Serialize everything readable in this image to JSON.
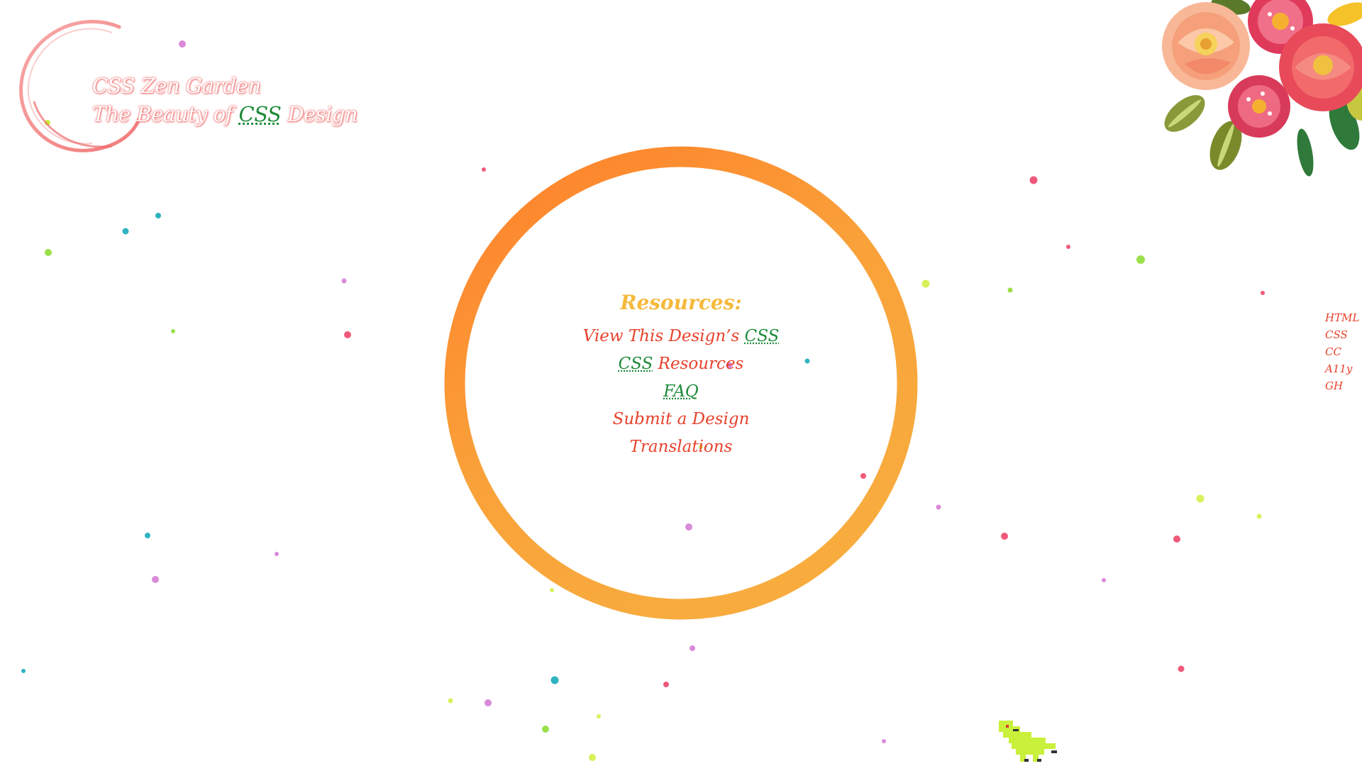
{
  "header": {
    "title": "CSS Zen Garden",
    "tagline_prefix": "The Beauty of ",
    "tagline_css": "CSS",
    "tagline_suffix": " Design"
  },
  "resources": {
    "heading": "Resources:",
    "links": [
      {
        "prefix": "View This Design’s ",
        "abbr": "CSS",
        "suffix": ""
      },
      {
        "prefix": "",
        "abbr": "CSS",
        "suffix": " Resources"
      },
      {
        "prefix": "",
        "abbr": "FAQ",
        "suffix": ""
      },
      {
        "prefix": "Submit a Design",
        "abbr": "",
        "suffix": ""
      },
      {
        "prefix": "Translations",
        "abbr": "",
        "suffix": ""
      }
    ]
  },
  "side_links": [
    "HTML",
    "CSS",
    "CC",
    "A11y",
    "GH"
  ],
  "colors": {
    "accent_red": "#e8412c",
    "accent_green": "#1e8a3a",
    "heading_gold": "#f5b93c",
    "ring_orange_start": "#ff7f2a",
    "ring_orange_end": "#f8ac3e",
    "dino_green": "#c9f03a"
  },
  "icons": {
    "logo_ring": "logo-ring-icon",
    "flowers": "flower-bouquet-icon",
    "dino": "pixel-dino-icon"
  }
}
